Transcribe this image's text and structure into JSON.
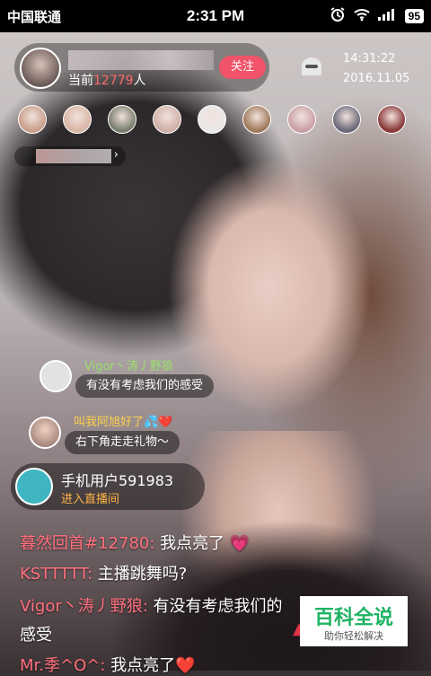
{
  "status_bar": {
    "carrier": "中国联通",
    "time": "2:31 PM",
    "battery": "95"
  },
  "host": {
    "count_prefix": "当前",
    "viewer_count": "12779",
    "count_suffix": "人",
    "follow_label": "关注"
  },
  "clock": {
    "time": "14:31:22",
    "date": "2016.11.05"
  },
  "viewers": [
    "#c9a08c",
    "#d8b6a6",
    "#7a7f6e",
    "#cfb0a8",
    "#e8e8e8",
    "#a07a5c",
    "#c9a1a7",
    "#6c6a7a",
    "#8a3a3a"
  ],
  "id_pill": {
    "chevron": "›"
  },
  "bubbles": [
    {
      "name": "Vigor丶涛丿野狼",
      "text": "有没有考虑我们的感受"
    },
    {
      "name": "叫我阿旭好了💦❤️",
      "text": "右下角走走礼物～"
    }
  ],
  "entry": {
    "name": "手机用户591983",
    "sub": "进入直播间"
  },
  "chat": [
    {
      "nick": "暮然回首#12780:",
      "text": " 我点亮了 💗"
    },
    {
      "nick": "KSTTTTT:",
      "text": " 主播跳舞吗?"
    },
    {
      "nick": "Vigor丶涛丿野狼:",
      "text": " 有没有考虑我们的"
    },
    {
      "nick": "",
      "text": "感受"
    },
    {
      "nick": "Mr.季^O^:",
      "text": " 我点亮了❤️"
    }
  ],
  "watermark": {
    "main": "百科全说",
    "sub": "助你轻松解决"
  }
}
